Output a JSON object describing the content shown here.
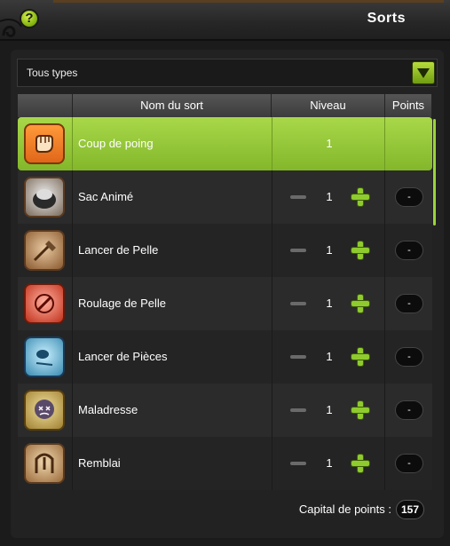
{
  "window": {
    "title": "Sorts",
    "help_label": "?"
  },
  "filter": {
    "selected": "Tous types"
  },
  "table": {
    "headers": {
      "name": "Nom du sort",
      "level": "Niveau",
      "points": "Points"
    },
    "rows": [
      {
        "name": "Coup de poing",
        "level": "1",
        "points": "",
        "icon": "fist-icon",
        "selected": true
      },
      {
        "name": "Sac Animé",
        "level": "1",
        "points": "-",
        "icon": "animated-bag-icon",
        "selected": false
      },
      {
        "name": "Lancer de Pelle",
        "level": "1",
        "points": "-",
        "icon": "shovel-throw-icon",
        "selected": false
      },
      {
        "name": "Roulage de Pelle",
        "level": "1",
        "points": "-",
        "icon": "shovel-roll-icon",
        "selected": false
      },
      {
        "name": "Lancer de Pièces",
        "level": "1",
        "points": "-",
        "icon": "coin-throw-icon",
        "selected": false
      },
      {
        "name": "Maladresse",
        "level": "1",
        "points": "-",
        "icon": "clumsiness-icon",
        "selected": false
      },
      {
        "name": "Remblai",
        "level": "1",
        "points": "-",
        "icon": "embankment-icon",
        "selected": false
      }
    ]
  },
  "footer": {
    "capital_label": "Capital de points :",
    "capital_value": "157"
  },
  "colors": {
    "accent": "#8fcb2e",
    "selected_row": "#9ccf3e"
  }
}
